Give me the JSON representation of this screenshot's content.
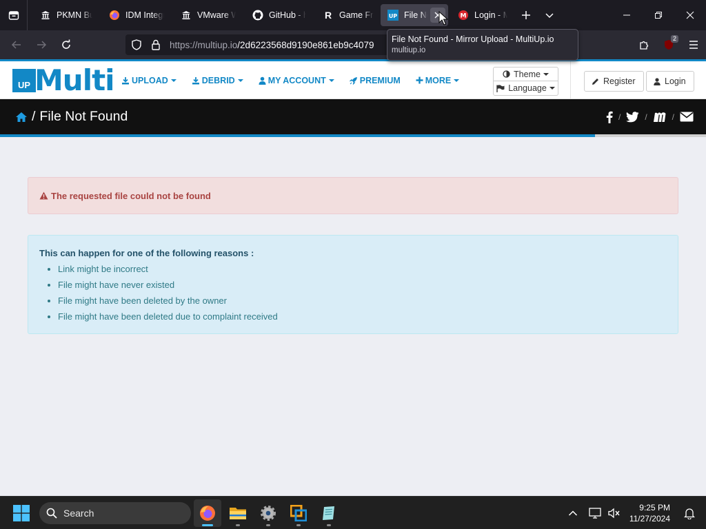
{
  "browser": {
    "tabs": [
      {
        "title": "PKMN Build",
        "icon": "bank-icon"
      },
      {
        "title": "IDM Integration",
        "icon": "firefox-icon"
      },
      {
        "title": "VMware Workstation",
        "icon": "bank-icon"
      },
      {
        "title": "GitHub - h",
        "icon": "github-icon"
      },
      {
        "title": "Game Freak",
        "icon": "r-icon"
      },
      {
        "title": "File Not Found",
        "icon": "multiup-icon",
        "active": true
      },
      {
        "title": "Login - MEGA",
        "icon": "mega-icon"
      }
    ],
    "url_host": "https://multiup.io",
    "url_path": "/2d6223568d9190e861eb9c4079",
    "extension_badge": "2",
    "tooltip": {
      "title": "File Not Found - Mirror Upload - MultiUp.io",
      "host": "multiup.io"
    }
  },
  "site": {
    "logo_up": "UP",
    "logo_text": "Multi",
    "menu": [
      {
        "label": "UPLOAD",
        "icon": "download-icon",
        "caret": true
      },
      {
        "label": "DEBRID",
        "icon": "download-icon",
        "caret": true
      },
      {
        "label": "MY ACCOUNT",
        "icon": "user-icon",
        "caret": true
      },
      {
        "label": "PREMIUM",
        "icon": "rocket-icon",
        "caret": false
      },
      {
        "label": "MORE",
        "icon": "plus-icon",
        "caret": true
      }
    ],
    "theme_label": "Theme",
    "language_label": "Language",
    "register_label": "Register",
    "login_label": "Login",
    "breadcrumb_sep": "/",
    "page_title": "File Not Found",
    "social_sep": "/",
    "progress_fraction": 0.843
  },
  "content": {
    "error_message": "The requested file could not be found",
    "reasons_heading": "This can happen for one of the following reasons :",
    "reasons": [
      "Link might be incorrect",
      "File might have never existed",
      "File might have been deleted by the owner",
      "File might have been deleted due to complaint received"
    ]
  },
  "taskbar": {
    "search_placeholder": "Search",
    "time": "9:25 PM",
    "date": "11/27/2024"
  },
  "colors": {
    "brand": "#1288c6",
    "danger_text": "#a94442",
    "info_text": "#31708f"
  }
}
